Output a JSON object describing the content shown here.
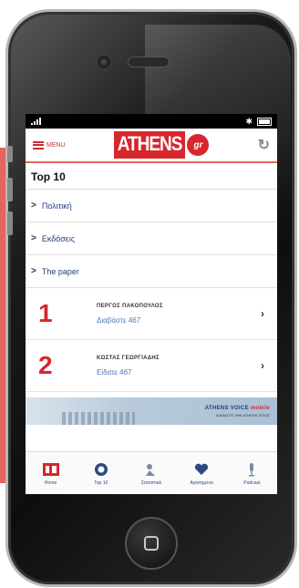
{
  "status": {
    "battery_bluetooth": "✱"
  },
  "appbar": {
    "menu_label": "MENU",
    "logo_main": "ATHENS",
    "logo_suffix": "gr"
  },
  "page": {
    "title": "Top 10"
  },
  "nav_items": [
    {
      "label": "Πολιτική"
    },
    {
      "label": "Εκδόσεις"
    },
    {
      "label": "The paper"
    }
  ],
  "rankings": [
    {
      "number": "1",
      "author": "ΠΕΡΓΟΣ ΠΑΚΟΠΟΥΛΟΣ",
      "subtitle": "Διαβάστε 467"
    },
    {
      "number": "2",
      "author": "ΚΩΣΤΑΣ ΓΕΩΡΓΙΑΔΗΣ",
      "subtitle": "Είδατε 467"
    }
  ],
  "banner": {
    "title_a": "ATHENS VOICE",
    "title_b": "mobile",
    "subtitle": "ΔΙΑΒΑΣΤΕ ΤΗΝ ATHENS VOICE"
  },
  "tabs": [
    {
      "label": "Home",
      "icon": "home-icon"
    },
    {
      "label": "Top 10",
      "icon": "top10-icon"
    },
    {
      "label": "Στατιστικά",
      "icon": "stats-icon"
    },
    {
      "label": "Αγαπημένα",
      "icon": "heart-icon"
    },
    {
      "label": "Podcast",
      "icon": "podcast-icon"
    }
  ],
  "colors": {
    "brand_red": "#d7262e",
    "side_banner": "#e4645f",
    "link_blue": "#1f3f7a"
  }
}
